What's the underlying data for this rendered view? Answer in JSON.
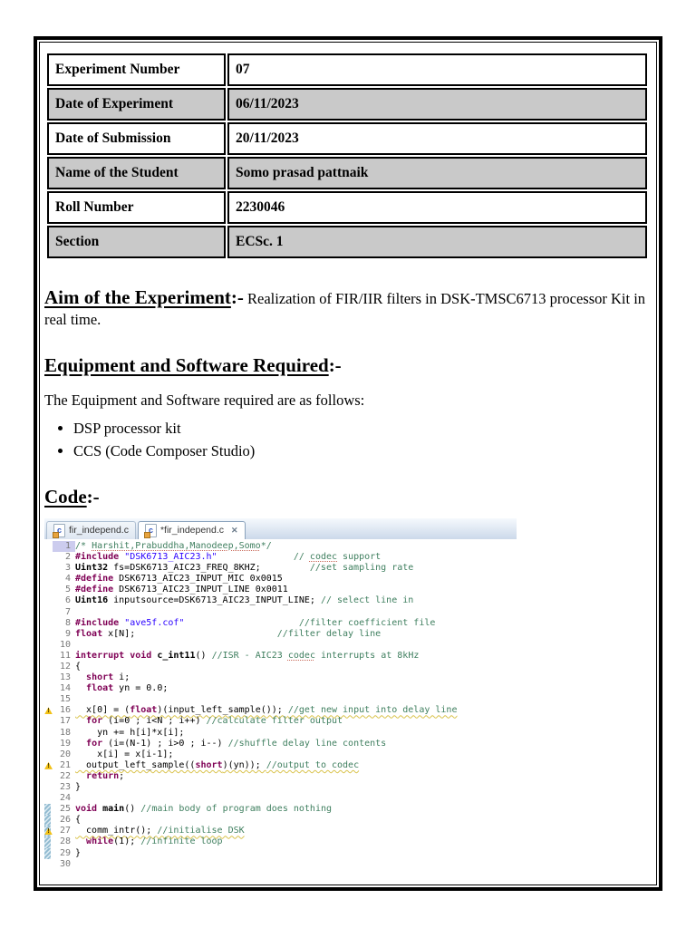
{
  "info_table": {
    "rows": [
      {
        "label": "Experiment Number",
        "value": "07"
      },
      {
        "label": "Date of Experiment",
        "value": "06/11/2023"
      },
      {
        "label": "Date of Submission",
        "value": "20/11/2023"
      },
      {
        "label": "Name of the Student",
        "value": "Somo prasad pattnaik"
      },
      {
        "label": "Roll Number",
        "value": "2230046"
      },
      {
        "label": "Section",
        "value": "ECSc. 1"
      }
    ]
  },
  "sections": {
    "aim": {
      "heading": "Aim of the Experiment",
      "sep": ":-",
      "text": " Realization of FIR/IIR filters in DSK-TMSC6713 processor Kit in real time."
    },
    "equipment": {
      "heading": "Equipment and Software Required",
      "sep": ":-",
      "intro": "The Equipment and Software required are as follows:",
      "items": [
        "DSP processor kit",
        "CCS (Code Composer Studio)"
      ]
    },
    "code": {
      "heading": "Code",
      "sep": ":-"
    }
  },
  "editor": {
    "tabs": [
      {
        "label": "fir_independ.c",
        "active": false
      },
      {
        "label": "*fir_independ.c",
        "active": true
      }
    ],
    "icons": {
      "file_glyph": "c",
      "close_glyph": "✕",
      "warning_glyph": "!"
    },
    "lines": [
      {
        "n": 1,
        "m": "",
        "hl": true,
        "s": [
          [
            "c",
            "/* "
          ],
          [
            "c d",
            "Harshit,Prabuddha,Manodeep,Somo"
          ],
          [
            "c",
            "*/"
          ]
        ]
      },
      {
        "n": 2,
        "m": "",
        "s": [
          [
            "k",
            "#include"
          ],
          [
            "p",
            " "
          ],
          [
            "s",
            "\"DSK6713_AIC23.h\""
          ],
          [
            "p",
            "              "
          ],
          [
            "c",
            "// "
          ],
          [
            "c d",
            "codec"
          ],
          [
            "c",
            " support"
          ]
        ]
      },
      {
        "n": 3,
        "m": "",
        "s": [
          [
            "t",
            "Uint32"
          ],
          [
            "p",
            " fs=DSK6713_AIC23_FREQ_8KHZ;"
          ],
          [
            "p",
            "         "
          ],
          [
            "c",
            "//set sampling rate"
          ]
        ]
      },
      {
        "n": 4,
        "m": "",
        "s": [
          [
            "k",
            "#define"
          ],
          [
            "p",
            " DSK6713_AIC23_INPUT_MIC 0x0015"
          ]
        ]
      },
      {
        "n": 5,
        "m": "",
        "s": [
          [
            "k",
            "#define"
          ],
          [
            "p",
            " DSK6713_AIC23_INPUT_LINE 0x0011"
          ]
        ]
      },
      {
        "n": 6,
        "m": "",
        "s": [
          [
            "t",
            "Uint16"
          ],
          [
            "p",
            " inputsource=DSK6713_AIC23_INPUT_LINE; "
          ],
          [
            "c",
            "// select line in"
          ]
        ]
      },
      {
        "n": 7,
        "m": "",
        "s": []
      },
      {
        "n": 8,
        "m": "",
        "s": [
          [
            "k",
            "#include"
          ],
          [
            "p",
            " "
          ],
          [
            "s",
            "\"ave5f.cof\""
          ],
          [
            "p",
            "                     "
          ],
          [
            "c",
            "//filter coefficient file"
          ]
        ]
      },
      {
        "n": 9,
        "m": "",
        "s": [
          [
            "k",
            "float"
          ],
          [
            "p",
            " x[N];"
          ],
          [
            "p",
            "                          "
          ],
          [
            "c",
            "//filter delay line"
          ]
        ]
      },
      {
        "n": 10,
        "m": "",
        "s": []
      },
      {
        "n": 11,
        "m": "",
        "s": [
          [
            "k",
            "interrupt"
          ],
          [
            "p",
            " "
          ],
          [
            "k",
            "void"
          ],
          [
            "p",
            " "
          ],
          [
            "t",
            "c_int11"
          ],
          [
            "p",
            "() "
          ],
          [
            "c",
            "//ISR - AIC23 "
          ],
          [
            "c d",
            "codec"
          ],
          [
            "c",
            " interrupts at 8kHz"
          ]
        ]
      },
      {
        "n": 12,
        "m": "",
        "s": [
          [
            "p",
            "{"
          ]
        ]
      },
      {
        "n": 13,
        "m": "",
        "s": [
          [
            "p",
            "  "
          ],
          [
            "k",
            "short"
          ],
          [
            "p",
            " i;"
          ]
        ]
      },
      {
        "n": 14,
        "m": "",
        "s": [
          [
            "p",
            "  "
          ],
          [
            "k",
            "float"
          ],
          [
            "p",
            " yn = 0.0;"
          ]
        ]
      },
      {
        "n": 15,
        "m": "",
        "s": []
      },
      {
        "n": 16,
        "m": "w",
        "s": [
          [
            "p w",
            "  x[0] = ("
          ],
          [
            "k w",
            "float"
          ],
          [
            "p w",
            ")(input_left_sample()); "
          ],
          [
            "c w",
            "//get new input into delay line"
          ]
        ]
      },
      {
        "n": 17,
        "m": "",
        "s": [
          [
            "p",
            "  "
          ],
          [
            "k",
            "for"
          ],
          [
            "p",
            " (i=0 ; i<N ; i++) "
          ],
          [
            "c",
            "//calculate filter output"
          ]
        ]
      },
      {
        "n": 18,
        "m": "",
        "s": [
          [
            "p",
            "    yn += h[i]*x[i];"
          ]
        ]
      },
      {
        "n": 19,
        "m": "",
        "s": [
          [
            "p",
            "  "
          ],
          [
            "k",
            "for"
          ],
          [
            "p",
            " (i=(N-1) ; i>0 ; i--) "
          ],
          [
            "c",
            "//shuffle delay line contents"
          ]
        ]
      },
      {
        "n": 20,
        "m": "",
        "s": [
          [
            "p",
            "    x[i] = x[i-1];"
          ]
        ]
      },
      {
        "n": 21,
        "m": "w",
        "s": [
          [
            "p w",
            "  output_left_sample(("
          ],
          [
            "k w",
            "short"
          ],
          [
            "p w",
            ")(yn)); "
          ],
          [
            "c w",
            "//output to codec"
          ]
        ]
      },
      {
        "n": 22,
        "m": "",
        "s": [
          [
            "p",
            "  "
          ],
          [
            "k",
            "return"
          ],
          [
            "p",
            ";"
          ]
        ]
      },
      {
        "n": 23,
        "m": "",
        "s": [
          [
            "p",
            "}"
          ]
        ]
      },
      {
        "n": 24,
        "m": "",
        "s": []
      },
      {
        "n": 25,
        "m": "b",
        "s": [
          [
            "k",
            "void"
          ],
          [
            "p",
            " "
          ],
          [
            "t",
            "main"
          ],
          [
            "p",
            "() "
          ],
          [
            "c",
            "//main body of program does nothing"
          ]
        ]
      },
      {
        "n": 26,
        "m": "b",
        "s": [
          [
            "p",
            "{"
          ]
        ]
      },
      {
        "n": 27,
        "m": "wb",
        "s": [
          [
            "p w",
            "  comm_intr(); "
          ],
          [
            "c w",
            "//initialise DSK"
          ]
        ]
      },
      {
        "n": 28,
        "m": "b",
        "s": [
          [
            "p",
            "  "
          ],
          [
            "k",
            "while"
          ],
          [
            "p",
            "(1); "
          ],
          [
            "c",
            "//infinite loop"
          ]
        ]
      },
      {
        "n": 29,
        "m": "b",
        "s": [
          [
            "p",
            "}"
          ]
        ]
      },
      {
        "n": 30,
        "m": "",
        "s": []
      }
    ]
  }
}
